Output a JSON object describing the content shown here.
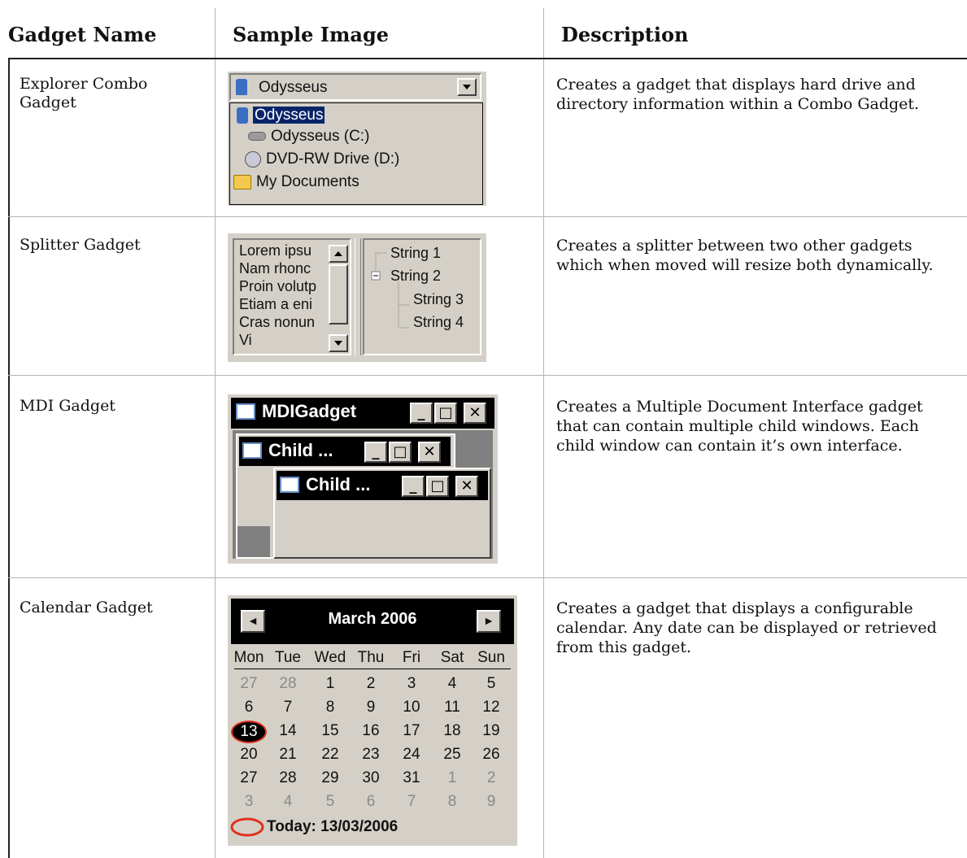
{
  "headers": {
    "col1": "Gadget Name",
    "col2": "Sample Image",
    "col3": "Description"
  },
  "rows": [
    {
      "name": "Explorer Combo Gadget",
      "description": "Creates a gadget that displays hard drive and directory information within a Combo Gadget."
    },
    {
      "name": "Splitter Gadget",
      "description": "Creates a splitter between two other gadgets which when moved will resize both dynamically."
    },
    {
      "name": "MDI Gadget",
      "description": "Creates a Multiple Document Interface gadget that can contain multiple child windows. Each child window can contain it’s own interface."
    },
    {
      "name": "Calendar Gadget",
      "description": "Creates a gadget that displays a configurable calendar. Any date can be displayed or retrieved from this gadget."
    }
  ],
  "combo": {
    "selected": "Odysseus",
    "items": [
      "Odysseus",
      "Odysseus (C:)",
      "DVD-RW Drive (D:)",
      "My Documents"
    ]
  },
  "splitter": {
    "left_lines": [
      "Lorem ipsu",
      "Nam rhonc",
      "Proin volutp",
      "Etiam a eni",
      "Cras nonun",
      "Vi"
    ],
    "tree": [
      "String 1",
      "String 2",
      "String 3",
      "String 4"
    ]
  },
  "mdi": {
    "title": "MDIGadget",
    "child1": "Child ...",
    "child2": "Child ...",
    "min": "_",
    "max": "□",
    "close": "✕"
  },
  "calendar": {
    "title": "March 2006",
    "prev": "◄",
    "next": "►",
    "days": [
      "Mon",
      "Tue",
      "Wed",
      "Thu",
      "Fri",
      "Sat",
      "Sun"
    ],
    "weeks": [
      [
        "27",
        "28",
        "1",
        "2",
        "3",
        "4",
        "5"
      ],
      [
        "6",
        "7",
        "8",
        "9",
        "10",
        "11",
        "12"
      ],
      [
        "13",
        "14",
        "15",
        "16",
        "17",
        "18",
        "19"
      ],
      [
        "20",
        "21",
        "22",
        "23",
        "24",
        "25",
        "26"
      ],
      [
        "27",
        "28",
        "29",
        "30",
        "31",
        "1",
        "2"
      ],
      [
        "3",
        "4",
        "5",
        "6",
        "7",
        "8",
        "9"
      ]
    ],
    "selected_day": "13",
    "today": "Today: 13/03/2006",
    "colors": {
      "header_bg": "#000000",
      "face": "#d4d0c8",
      "circle": "#e0301e",
      "selection": "#0a246a"
    }
  }
}
